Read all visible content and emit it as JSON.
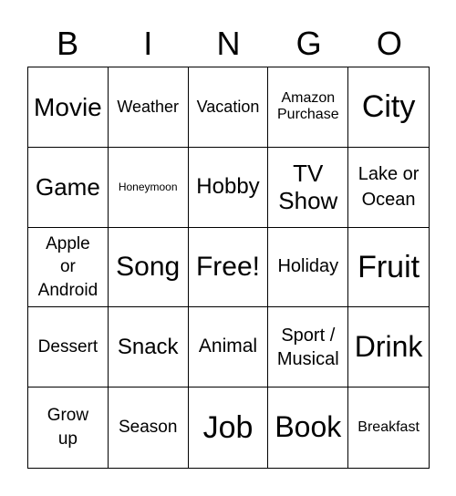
{
  "header": [
    "B",
    "I",
    "N",
    "G",
    "O"
  ],
  "cells": [
    "Movie",
    "Weather",
    "Vacation",
    "Amazon Purchase",
    "City",
    "Game",
    "Honeymoon",
    "Hobby",
    "TV Show",
    "Lake or Ocean",
    "Apple or Android",
    "Song",
    "Free!",
    "Holiday",
    "Fruit",
    "Dessert",
    "Snack",
    "Animal",
    "Sport / Musical",
    "Drink",
    "Grow up",
    "Season",
    "Job",
    "Book",
    "Breakfast"
  ]
}
